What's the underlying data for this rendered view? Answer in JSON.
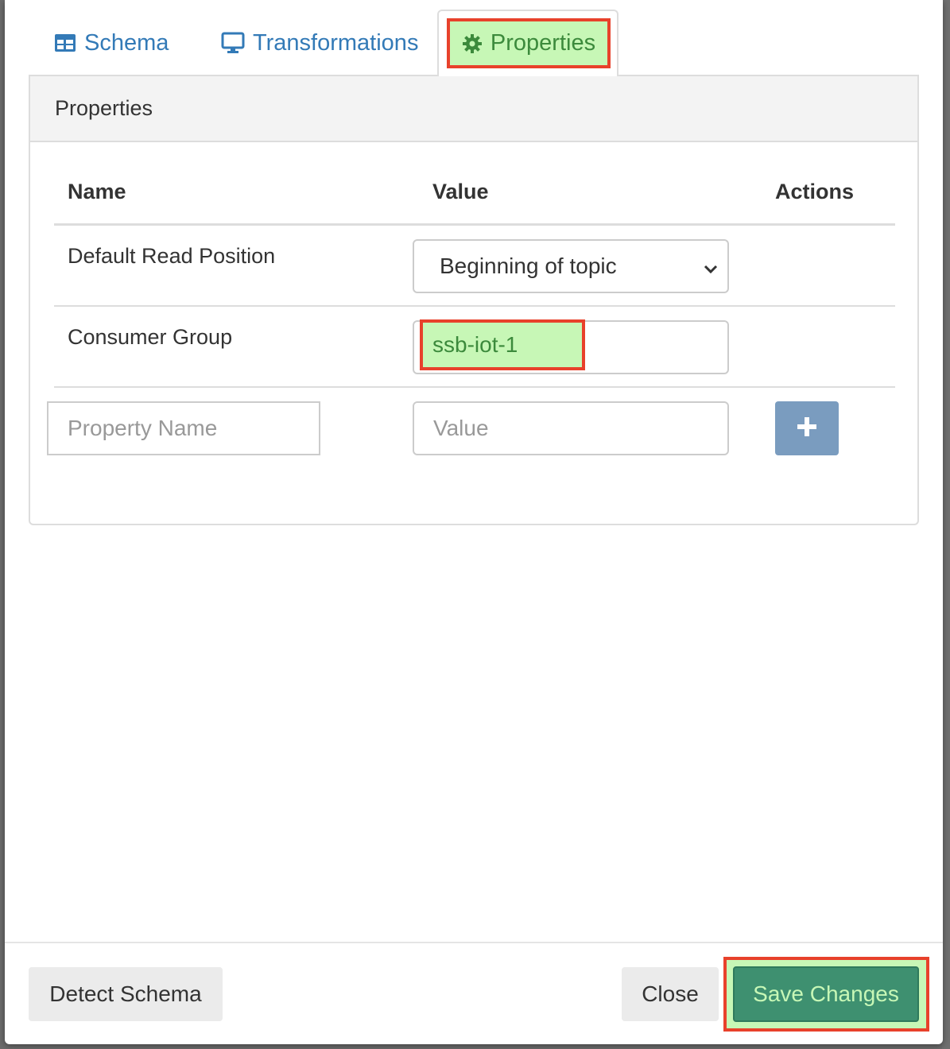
{
  "tabs": {
    "schema_label": "Schema",
    "transformations_label": "Transformations",
    "properties_label": "Properties"
  },
  "panel": {
    "heading": "Properties",
    "columns": {
      "name": "Name",
      "value": "Value",
      "actions": "Actions"
    },
    "rows": [
      {
        "name": "Default Read Position",
        "value": "Beginning of topic"
      },
      {
        "name": "Consumer Group",
        "value": "ssb-iot-1"
      }
    ],
    "new_row": {
      "name_placeholder": "Property Name",
      "value_placeholder": "Value"
    }
  },
  "footer": {
    "detect_schema_label": "Detect Schema",
    "close_label": "Close",
    "save_label": "Save Changes"
  },
  "icons": {
    "schema": "table-icon",
    "transformations": "monitor-icon",
    "properties": "gear-icon",
    "add": "plus-icon",
    "select": "chevron-down-icon"
  },
  "colors": {
    "link": "#337ab7",
    "highlight_fill": "#c7f7b6",
    "highlight_border": "#e8412b",
    "save_button": "#3e9070",
    "add_button": "#7a9cbf"
  }
}
